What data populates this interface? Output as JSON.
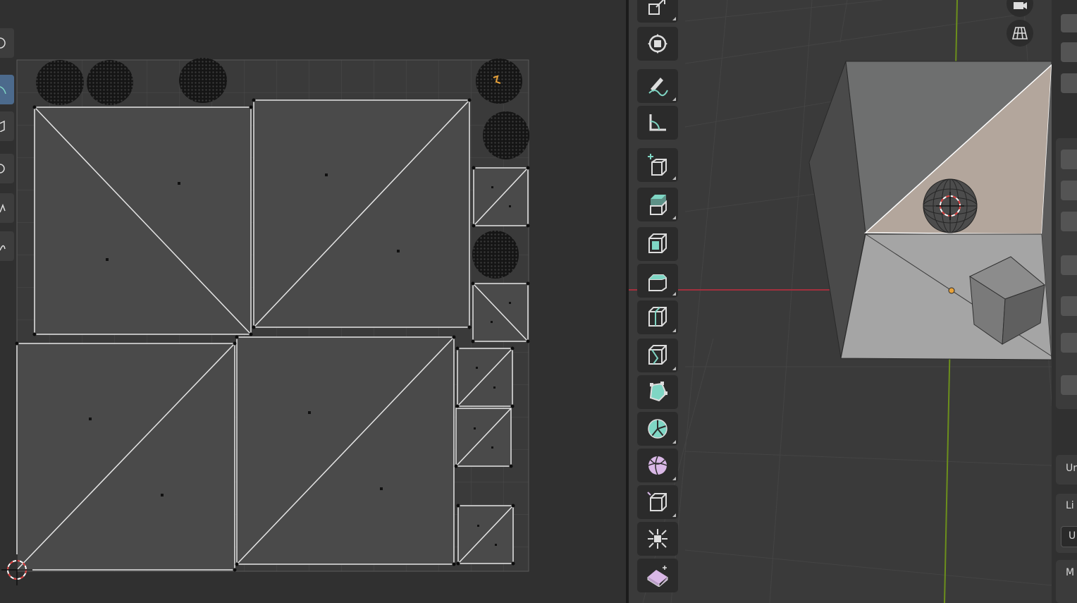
{
  "uv_editor": {
    "toolbar_icons": [
      "rotate-icon",
      "curve-icon",
      "box-icon",
      "half-circle-icon",
      "grab-icon",
      "pinch-icon"
    ]
  },
  "viewport": {
    "tools": [
      {
        "name": "scale-tool",
        "icon": "scale-icon"
      },
      {
        "name": "transform-tool",
        "icon": "transform-icon"
      },
      {
        "name": "annotate-tool",
        "icon": "annotate-pencil-icon"
      },
      {
        "name": "measure-tool",
        "icon": "ruler-icon"
      },
      {
        "name": "add-cube-tool",
        "icon": "add-cube-icon"
      },
      {
        "name": "extrude-region-tool",
        "icon": "extrude-icon"
      },
      {
        "name": "inset-faces-tool",
        "icon": "inset-icon"
      },
      {
        "name": "bevel-tool",
        "icon": "bevel-icon"
      },
      {
        "name": "loop-cut-tool",
        "icon": "loop-cut-icon"
      },
      {
        "name": "knife-tool",
        "icon": "knife-icon"
      },
      {
        "name": "poly-build-tool",
        "icon": "poly-build-icon"
      },
      {
        "name": "spin-tool",
        "icon": "spin-icon"
      },
      {
        "name": "smooth-tool",
        "icon": "smooth-icon"
      },
      {
        "name": "edge-slide-tool",
        "icon": "edge-slide-icon"
      },
      {
        "name": "shrink-fatten-tool",
        "icon": "shrink-fatten-icon"
      },
      {
        "name": "shear-tool",
        "icon": "shear-icon"
      }
    ],
    "nav_icons": [
      "camera-icon",
      "perspective-grid-icon"
    ],
    "colors": {
      "x_axis": "#a2303d",
      "y_axis": "#6c8f1c",
      "active_face": "#b3a69c",
      "origin": "#e8a23a"
    }
  },
  "properties_panel": {
    "labels": [
      "Ur",
      "Li",
      "U",
      "M"
    ]
  }
}
